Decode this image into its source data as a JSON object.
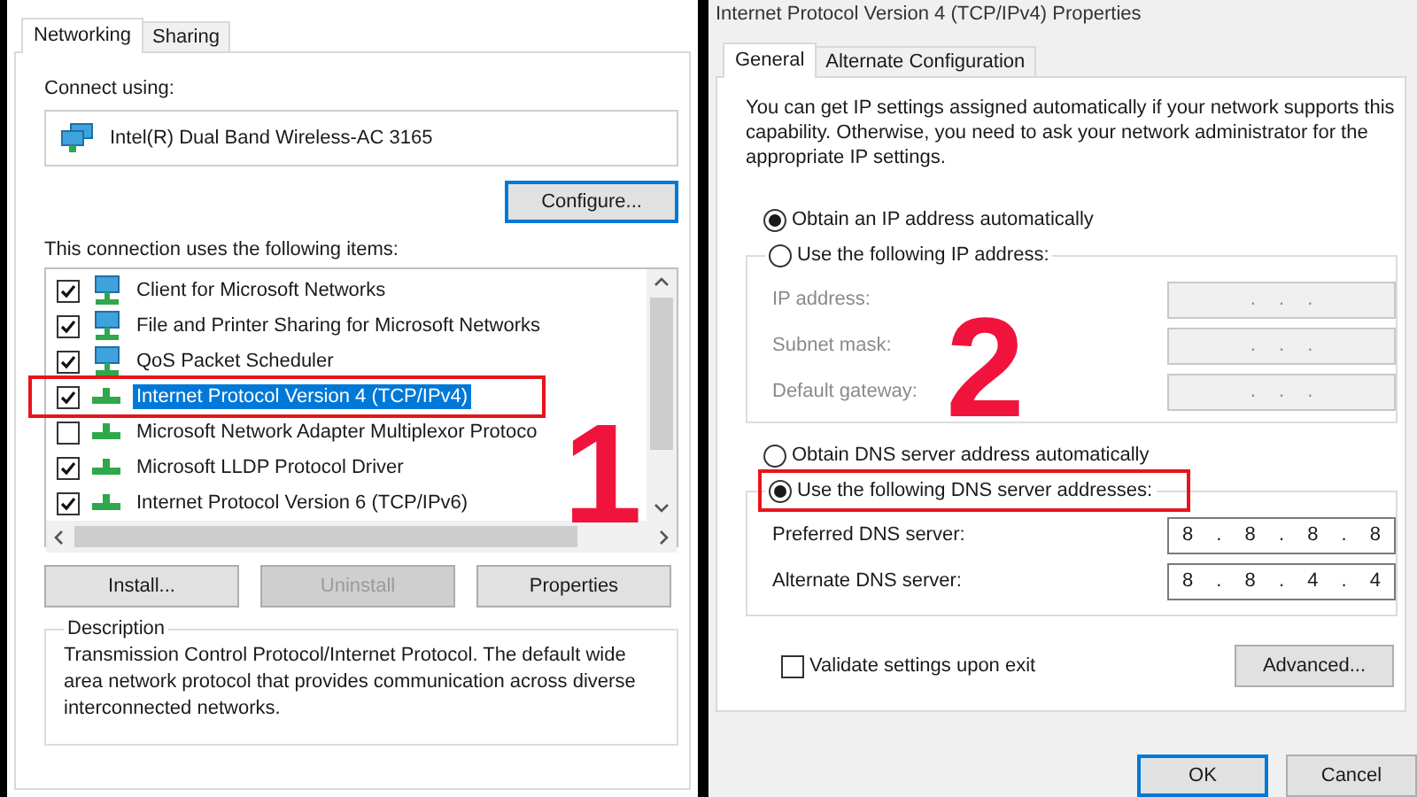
{
  "left_dialog": {
    "tabs": [
      {
        "label": "Networking",
        "selected": true
      },
      {
        "label": "Sharing",
        "selected": false
      }
    ],
    "connect_using_label": "Connect using:",
    "adapter": "Intel(R) Dual Band Wireless-AC 3165",
    "configure_button": {
      "label": "Configure...",
      "focused": true
    },
    "items_label": "This connection uses the following items:",
    "items": [
      {
        "label": "Client for Microsoft Networks",
        "checked": true,
        "selected": false,
        "highlighted": false,
        "kind": "client"
      },
      {
        "label": "File and Printer Sharing for Microsoft Networks",
        "checked": true,
        "selected": false,
        "highlighted": false,
        "kind": "client"
      },
      {
        "label": "QoS Packet Scheduler",
        "checked": true,
        "selected": false,
        "highlighted": false,
        "kind": "client"
      },
      {
        "label": "Internet Protocol Version 4 (TCP/IPv4)",
        "checked": true,
        "selected": true,
        "highlighted": true,
        "kind": "protocol"
      },
      {
        "label": "Microsoft Network Adapter Multiplexor Protoco",
        "checked": false,
        "selected": false,
        "highlighted": false,
        "kind": "protocol"
      },
      {
        "label": "Microsoft LLDP Protocol Driver",
        "checked": true,
        "selected": false,
        "highlighted": false,
        "kind": "protocol"
      },
      {
        "label": "Internet Protocol Version 6 (TCP/IPv6)",
        "checked": true,
        "selected": false,
        "highlighted": false,
        "kind": "protocol"
      }
    ],
    "buttons": [
      {
        "label": "Install...",
        "disabled": false
      },
      {
        "label": "Uninstall",
        "disabled": true
      },
      {
        "label": "Properties",
        "disabled": false
      }
    ],
    "description": {
      "title": "Description",
      "text": "Transmission Control Protocol/Internet Protocol. The default wide area network protocol that provides communication across diverse interconnected networks."
    },
    "annotation_number": "1"
  },
  "right_dialog": {
    "title": "Internet Protocol Version 4 (TCP/IPv4) Properties",
    "tabs": [
      {
        "label": "General",
        "selected": true
      },
      {
        "label": "Alternate Configuration",
        "selected": false
      }
    ],
    "intro": "You can get IP settings assigned automatically if your network supports this capability. Otherwise, you need to ask your network administrator for the appropriate IP settings.",
    "ip_options": [
      {
        "label": "Obtain an IP address automatically",
        "selected": true,
        "highlighted": false
      },
      {
        "label": "Use the following IP address:",
        "selected": false,
        "highlighted": false
      }
    ],
    "ip_fields": [
      {
        "label": "IP address:",
        "value": ". . .",
        "disabled": true
      },
      {
        "label": "Subnet mask:",
        "value": ". . .",
        "disabled": true
      },
      {
        "label": "Default gateway:",
        "value": ". . .",
        "disabled": true
      }
    ],
    "dns_options": [
      {
        "label": "Obtain DNS server address automatically",
        "selected": false,
        "highlighted": false
      },
      {
        "label": "Use the following DNS server addresses:",
        "selected": true,
        "highlighted": true
      }
    ],
    "dns_fields": [
      {
        "label": "Preferred DNS server:",
        "value": "8 . 8 . 8 . 8",
        "disabled": false
      },
      {
        "label": "Alternate DNS server:",
        "value": "8 . 8 . 4 . 4",
        "disabled": false
      }
    ],
    "validate": {
      "label": "Validate settings upon exit",
      "checked": false
    },
    "advanced_button": {
      "label": "Advanced...",
      "focused": false
    },
    "buttons": [
      {
        "label": "OK",
        "focused": true
      },
      {
        "label": "Cancel",
        "focused": false
      }
    ],
    "annotation_number": "2"
  }
}
